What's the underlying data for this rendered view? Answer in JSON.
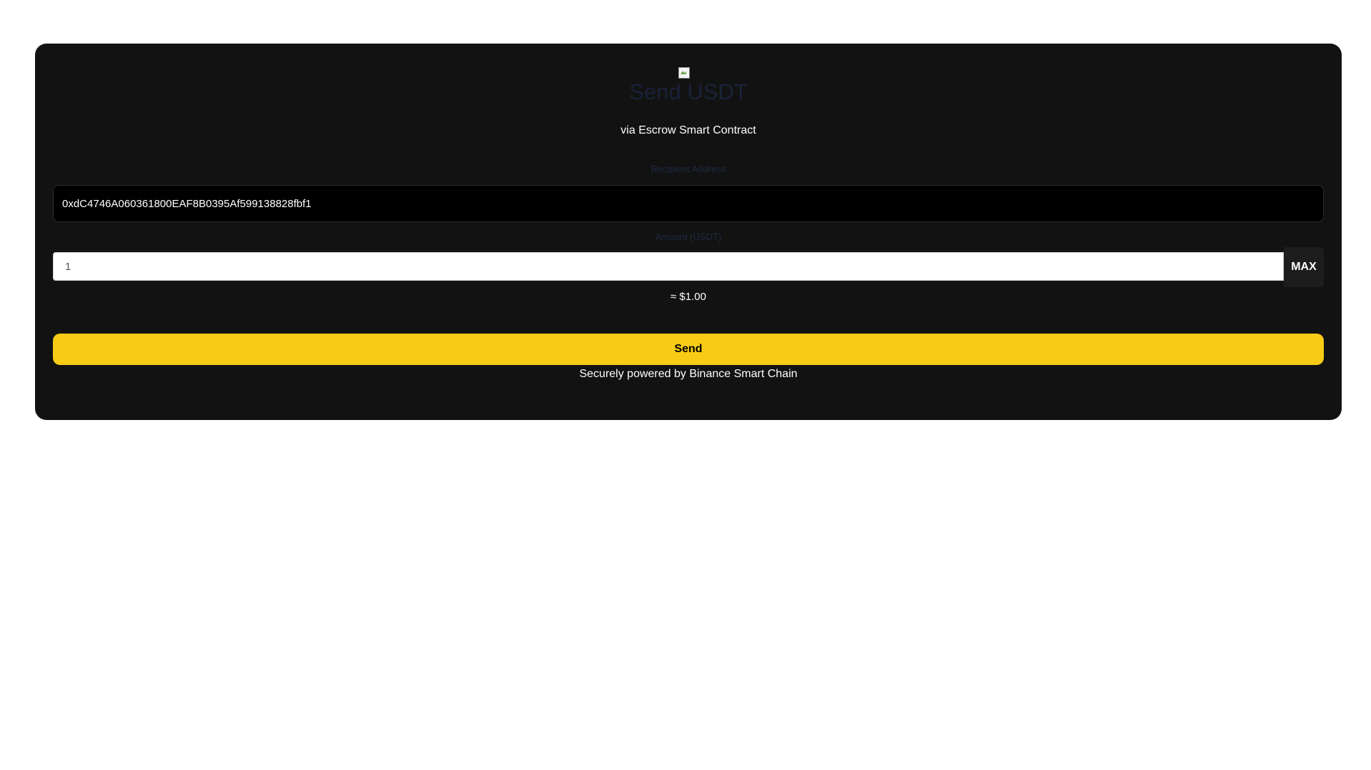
{
  "header": {
    "logo_icon": "broken-image-icon",
    "title": "Send USDT",
    "subtitle": "via Escrow Smart Contract"
  },
  "form": {
    "recipient_label": "Recipient Address",
    "recipient_value": "0xdC4746A060361800EAF8B0395Af599138828fbf1",
    "amount_label": "Amount (USDT)",
    "amount_value": "1",
    "max_label": "MAX",
    "usd_estimate": "≈ $1.00",
    "send_label": "Send"
  },
  "footer": {
    "text": "Securely powered by Binance Smart Chain"
  },
  "colors": {
    "card_background": "#121212",
    "accent": "#f8cc16",
    "title": "#1a2238"
  }
}
